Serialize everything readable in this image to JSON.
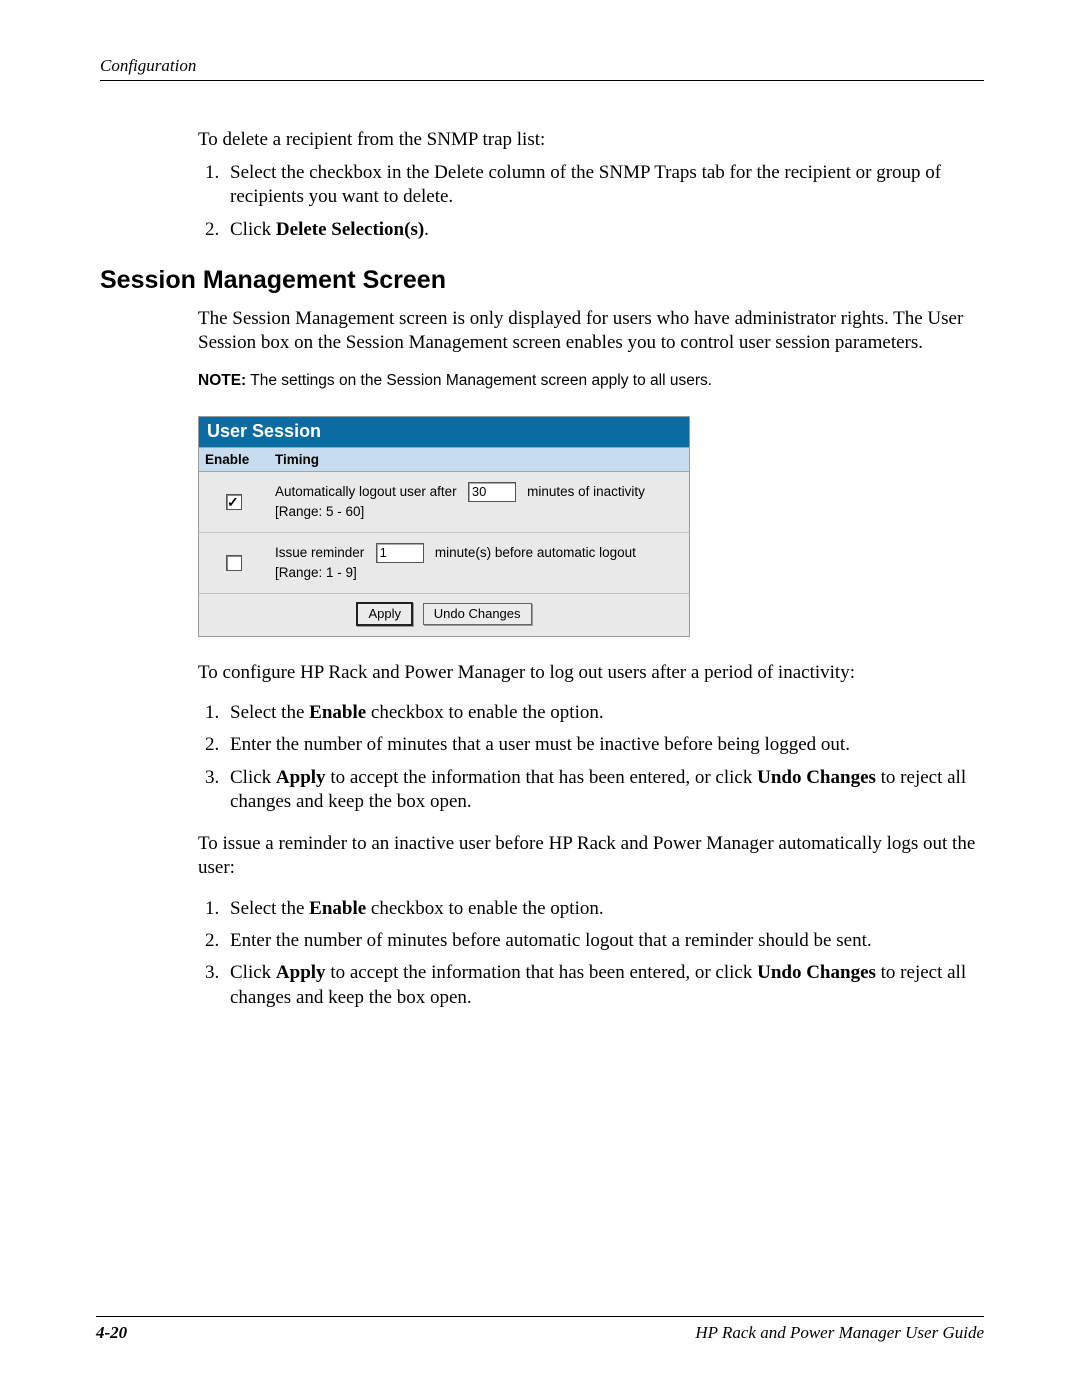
{
  "header": {
    "section": "Configuration"
  },
  "intro": {
    "p1": "To delete a recipient from the SNMP trap list:",
    "li1": "Select the checkbox in the Delete column of the SNMP Traps tab for the recipient or group of recipients you want to delete.",
    "li2_pre": "Click ",
    "li2_bold": "Delete Selection(s)",
    "li2_post": "."
  },
  "h2": "Session Management Screen",
  "sm_para": "The Session Management screen is only displayed for users who have administrator rights. The User Session box on the Session Management screen enables you to control user session parameters.",
  "note": {
    "label": "NOTE:",
    "text": "  The settings on the Session Management screen apply to all users."
  },
  "panel": {
    "title": "User Session",
    "col_enable": "Enable",
    "col_timing": "Timing",
    "row1_pre": "Automatically logout user after",
    "row1_value": "30",
    "row1_post": "minutes of inactivity [Range: 5 - 60]",
    "row2_pre": "Issue reminder",
    "row2_value": "1",
    "row2_post": "minute(s) before automatic logout [Range: 1 - 9]",
    "apply": "Apply",
    "undo": "Undo Changes"
  },
  "config_intro": "To configure HP Rack and Power Manager to log out users after a period of inactivity:",
  "cfg": {
    "li1_pre": "Select the ",
    "li1_bold": "Enable",
    "li1_post": " checkbox to enable the option.",
    "li2": "Enter the number of minutes that a user must be inactive before being logged out.",
    "li3_pre": "Click ",
    "li3_b1": "Apply",
    "li3_mid": " to accept the information that has been entered, or click ",
    "li3_b2": "Undo Changes",
    "li3_post": " to reject all changes and keep the box open."
  },
  "reminder_intro": "To issue a reminder to an inactive user before HP Rack and Power Manager automatically logs out the user:",
  "rem": {
    "li1_pre": "Select the ",
    "li1_bold": "Enable",
    "li1_post": " checkbox to enable the option.",
    "li2": "Enter the number of minutes before automatic logout that a reminder should be sent.",
    "li3_pre": "Click ",
    "li3_b1": "Apply",
    "li3_mid": " to accept the information that has been entered, or click ",
    "li3_b2": "Undo Changes",
    "li3_post": " to reject all changes and keep the box open."
  },
  "footer": {
    "page": "4-20",
    "guide": "HP Rack and Power Manager User Guide"
  }
}
